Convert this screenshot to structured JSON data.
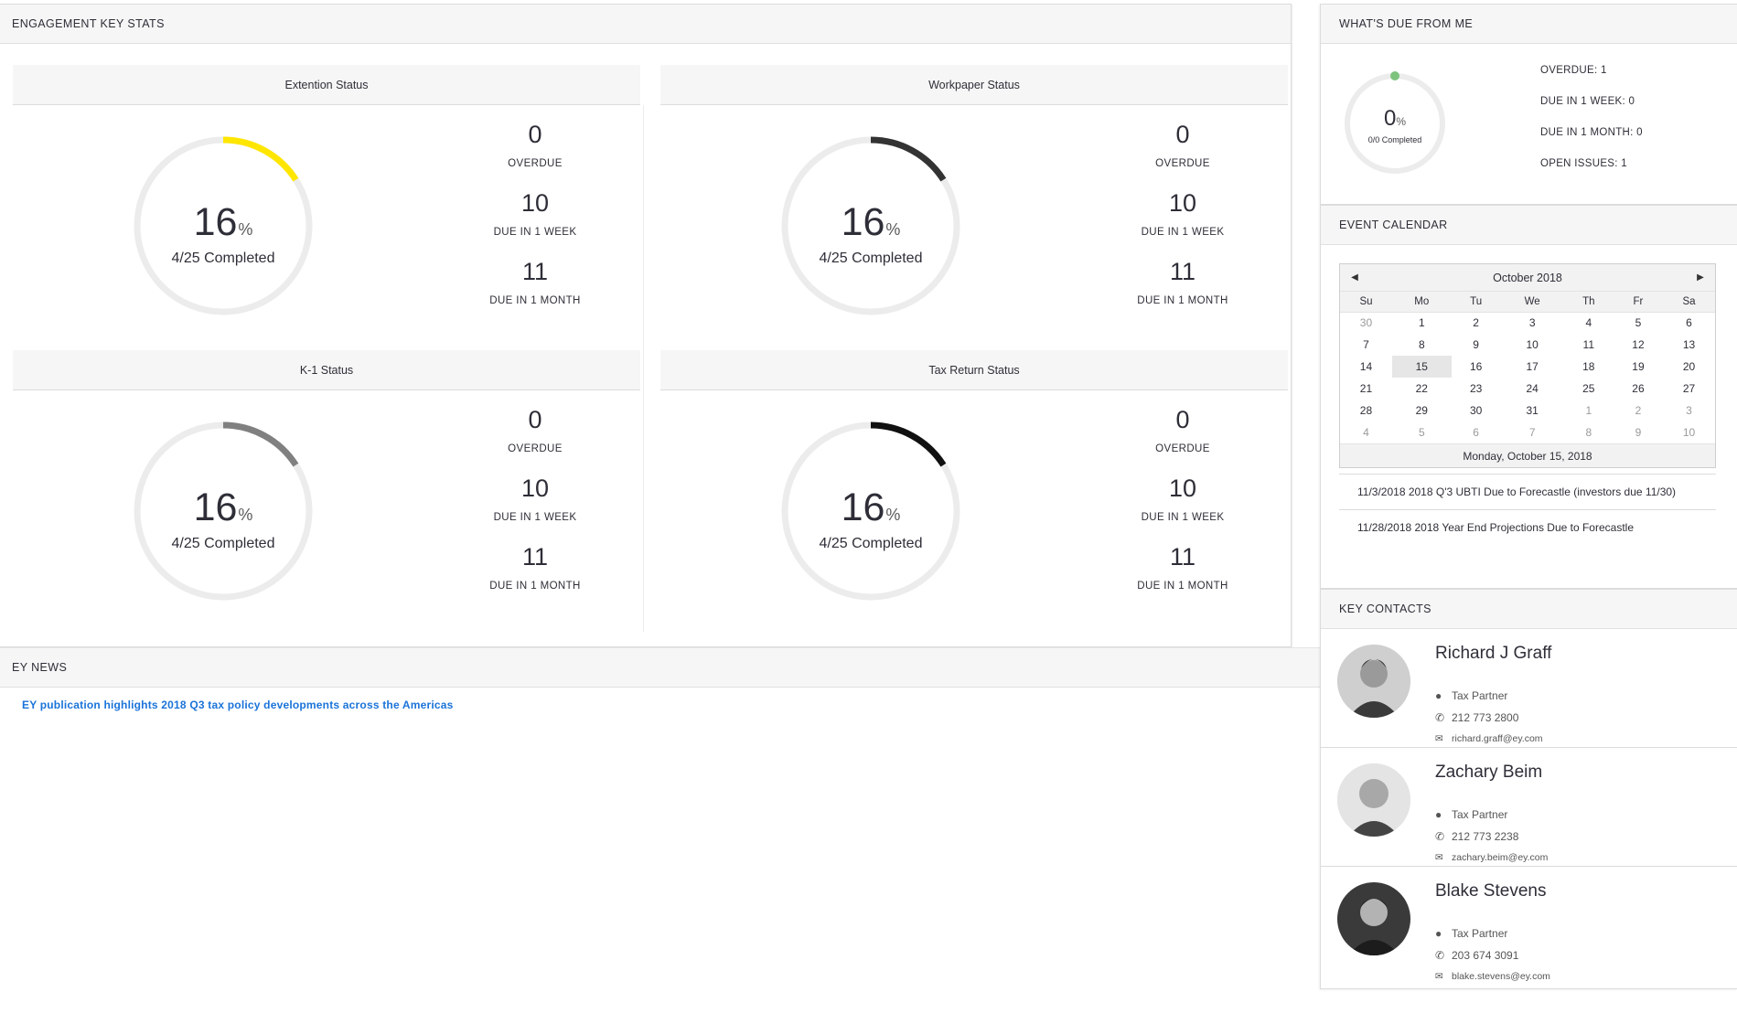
{
  "engagement": {
    "title": "ENGAGEMENT KEY STATS",
    "cards": [
      {
        "title": "Extention Status",
        "percent": 16,
        "percent_symbol": "%",
        "completed": "4/25 Completed",
        "arc_color": "#ffe600",
        "overdue": "0",
        "overdue_label": "OVERDUE",
        "week": "10",
        "week_label": "DUE IN 1 WEEK",
        "month": "11",
        "month_label": "DUE IN 1 MONTH"
      },
      {
        "title": "Workpaper Status",
        "percent": 16,
        "percent_symbol": "%",
        "completed": "4/25 Completed",
        "arc_color": "#333333",
        "overdue": "0",
        "overdue_label": "OVERDUE",
        "week": "10",
        "week_label": "DUE IN 1 WEEK",
        "month": "11",
        "month_label": "DUE IN 1 MONTH"
      },
      {
        "title": "K-1 Status",
        "percent": 16,
        "percent_symbol": "%",
        "completed": "4/25 Completed",
        "arc_color": "#808080",
        "overdue": "0",
        "overdue_label": "OVERDUE",
        "week": "10",
        "week_label": "DUE IN 1 WEEK",
        "month": "11",
        "month_label": "DUE IN 1 MONTH"
      },
      {
        "title": "Tax Return Status",
        "percent": 16,
        "percent_symbol": "%",
        "completed": "4/25 Completed",
        "arc_color": "#111111",
        "overdue": "0",
        "overdue_label": "OVERDUE",
        "week": "10",
        "week_label": "DUE IN 1 WEEK",
        "month": "11",
        "month_label": "DUE IN 1 MONTH"
      }
    ],
    "track_color": "#ececec"
  },
  "news": {
    "title": "EY NEWS",
    "link": "EY publication highlights 2018 Q3 tax policy developments across the Americas",
    "link_color": "#1a73d9"
  },
  "due": {
    "title": "WHAT'S DUE FROM ME",
    "percent": 0,
    "percent_symbol": "%",
    "completed": "0/0 Completed",
    "dot_color": "#7dc37d",
    "items": [
      "OVERDUE: 1",
      "DUE IN 1 WEEK: 0",
      "DUE IN 1 MONTH: 0",
      "OPEN ISSUES: 1"
    ]
  },
  "calendar": {
    "title": "EVENT CALENDAR",
    "month": "October 2018",
    "prev_icon": "caret-left-icon",
    "next_icon": "caret-right-icon",
    "weekdays": [
      "Su",
      "Mo",
      "Tu",
      "We",
      "Th",
      "Fr",
      "Sa"
    ],
    "weeks": [
      [
        "30",
        "1",
        "2",
        "3",
        "4",
        "5",
        "6"
      ],
      [
        "7",
        "8",
        "9",
        "10",
        "11",
        "12",
        "13"
      ],
      [
        "14",
        "15",
        "16",
        "17",
        "18",
        "19",
        "20"
      ],
      [
        "21",
        "22",
        "23",
        "24",
        "25",
        "26",
        "27"
      ],
      [
        "28",
        "29",
        "30",
        "31",
        "1",
        "2",
        "3"
      ],
      [
        "4",
        "5",
        "6",
        "7",
        "8",
        "9",
        "10"
      ]
    ],
    "selected": "15",
    "footer": "Monday, October 15, 2018",
    "events": [
      "11/3/2018 2018 Q'3 UBTI Due to Forecastle (investors due 11/30)",
      "11/28/2018 2018 Year End Projections Due to Forecastle"
    ]
  },
  "contacts": {
    "title": "KEY CONTACTS",
    "people": [
      {
        "name": "Richard J Graff",
        "role": "Tax Partner",
        "phone": "212 773 2800",
        "email": "richard.graff@ey.com"
      },
      {
        "name": "Zachary Beim",
        "role": "Tax Partner",
        "phone": "212 773 2238",
        "email": "zachary.beim@ey.com"
      },
      {
        "name": "Blake Stevens",
        "role": "Tax Partner",
        "phone": "203 674 3091",
        "email": "blake.stevens@ey.com"
      }
    ]
  }
}
